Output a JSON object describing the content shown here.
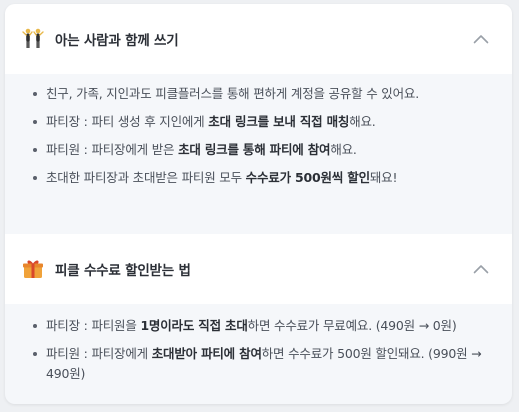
{
  "section1": {
    "title": "아는 사람과 함께 쓰기",
    "icon": "two-people-icon",
    "items": [
      {
        "pre": "친구, 가족, 지인과도 피클플러스를 통해 편하게 계정을 공유할 수 있어요.",
        "bold": "",
        "post": ""
      },
      {
        "pre": "파티장 : 파티 생성 후 지인에게 ",
        "bold": "초대 링크를 보내 직접 매칭",
        "post": "해요."
      },
      {
        "pre": "파티원 : 파티장에게 받은 ",
        "bold": "초대 링크를 통해 파티에 참여",
        "post": "해요."
      },
      {
        "pre": "초대한 파티장과 초대받은 파티원 모두 ",
        "bold": "수수료가 500원씩 할인",
        "post": "돼요!"
      }
    ]
  },
  "section2": {
    "title": "피클 수수료 할인받는 법",
    "icon": "gift-icon",
    "items": [
      {
        "pre": "파티장 : 파티원을 ",
        "bold": "1명이라도 직접 초대",
        "post": "하면 수수료가 무료예요. (490원 → 0원)"
      },
      {
        "pre": "파티원 : 파티장에게 ",
        "bold": "초대받아 파티에 참여",
        "post": "하면 수수료가 500원 할인돼요. (990원 → 490원)"
      }
    ]
  }
}
